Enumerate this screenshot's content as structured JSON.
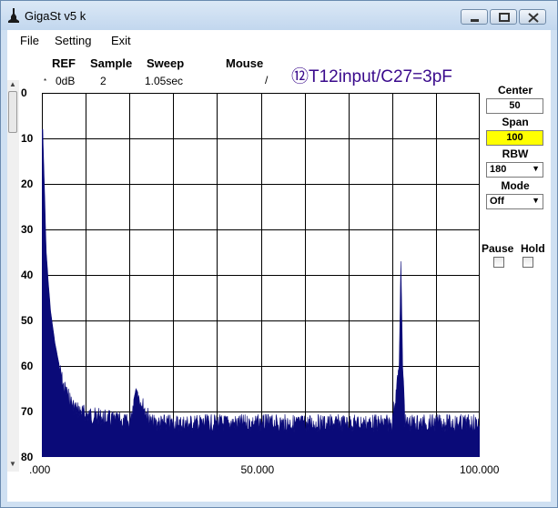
{
  "window": {
    "title": "GigaSt v5 k"
  },
  "menu": {
    "file": "File",
    "setting": "Setting",
    "exit": "Exit"
  },
  "header": {
    "ref_label": "REF",
    "ref_value": "0dB",
    "ref_marker": "*",
    "sample_label": "Sample",
    "sample_value": "2",
    "sweep_label": "Sweep",
    "sweep_value": "1.05sec",
    "mouse_label": "Mouse",
    "mouse_value": "/"
  },
  "annotation": "⑫T12input/C27=3pF",
  "controls": {
    "center_label": "Center",
    "center_value": "50",
    "span_label": "Span",
    "span_value": "100",
    "rbw_label": "RBW",
    "rbw_value": "180",
    "mode_label": "Mode",
    "mode_value": "Off",
    "pause_label": "Pause",
    "hold_label": "Hold"
  },
  "colors": {
    "trace": "#0a0a78",
    "span_bg": "#ffff00",
    "annotation": "#3a0a8c",
    "grid": "#000000"
  },
  "chart_data": {
    "type": "area",
    "x_ticks": [
      ".000",
      "50.000",
      "100.000"
    ],
    "y_ticks": [
      "0",
      "10",
      "20",
      "30",
      "40",
      "50",
      "60",
      "70",
      "80"
    ],
    "xlim": [
      0,
      100
    ],
    "ylim": [
      0,
      80
    ],
    "y_inverted": true,
    "grid": true,
    "x": [
      0.2,
      0.5,
      1,
      1.5,
      2,
      3,
      4,
      5,
      6,
      7,
      8,
      10,
      15,
      20,
      21.5,
      25,
      30,
      40,
      50,
      60,
      70,
      80,
      81.6,
      82,
      82.4,
      83,
      90,
      95,
      100
    ],
    "y": [
      8,
      18,
      35,
      42,
      48,
      55,
      60,
      64,
      66,
      68,
      69,
      70,
      71,
      72,
      65,
      72,
      72,
      72,
      72,
      72,
      72,
      72,
      60,
      37,
      60,
      72,
      72,
      72,
      72
    ]
  }
}
